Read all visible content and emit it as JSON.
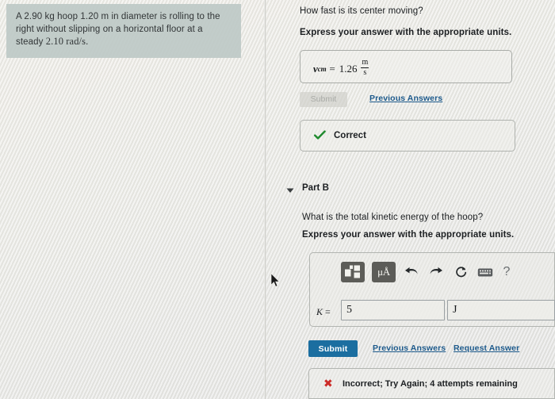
{
  "problem": {
    "text_lead": "A 2.90 kg hoop 1.20 m in diameter is rolling to the right without slipping on a horizontal floor at a steady ",
    "text_math": "2.10 rad/s.",
    "full_text": "A 2.90 kg hoop 1.20 m in diameter is rolling to the right without slipping on a horizontal floor at a steady 2.10 rad/s.",
    "mass": "2.90 kg",
    "diameter": "1.20 m",
    "angular_speed": "2.10 rad/s",
    "background_color": "#bfcac7"
  },
  "part_a": {
    "question": "How fast is its center moving?",
    "instruction": "Express your answer with the appropriate units.",
    "answer": {
      "symbol": "v",
      "subscript": "cm",
      "equals": "=",
      "value": "1.26",
      "unit_numerator": "m",
      "unit_denominator": "s"
    },
    "submit_label": "Submit",
    "previous_answers_label": "Previous Answers",
    "feedback": {
      "icon": "check-icon",
      "label": "Correct",
      "color": "#1f8a2e"
    }
  },
  "part_b": {
    "title": "Part B",
    "toggle_icon": "triangle-down-icon",
    "question": "What is the total kinetic energy of the hoop?",
    "instruction": "Express your answer with the appropriate units.",
    "toolbar": {
      "items": [
        {
          "name": "math-template-icon",
          "label": ""
        },
        {
          "name": "units-icon",
          "label": "μÅ"
        },
        {
          "name": "undo-icon",
          "label": ""
        },
        {
          "name": "redo-icon",
          "label": ""
        },
        {
          "name": "reset-icon",
          "label": ""
        },
        {
          "name": "keyboard-icon",
          "label": ""
        },
        {
          "name": "help-icon",
          "label": "?"
        }
      ]
    },
    "input": {
      "variable": "K",
      "equals": "=",
      "value": "5",
      "units_value": "J"
    },
    "submit_label": "Submit",
    "previous_answers_label": "Previous Answers",
    "request_answer_label": "Request Answer",
    "feedback": {
      "icon": "x-icon",
      "label": "Incorrect; Try Again; 4 attempts remaining",
      "color": "#cc2b28"
    }
  },
  "theme": {
    "link_color": "#1d5a8c",
    "submit_active_color": "#1b6ea0",
    "page_background": "#e8e8e4"
  }
}
